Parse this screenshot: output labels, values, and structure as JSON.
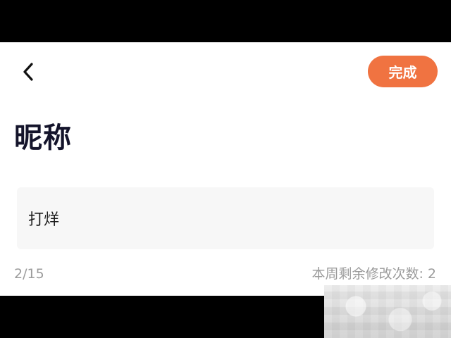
{
  "colors": {
    "accent": "#F07341",
    "title": "#14142B",
    "input_background": "#F7F7F7",
    "input_text": "#1A1A1A",
    "muted_text": "#9B9B9B"
  },
  "header": {
    "back_icon": "chevron-left-icon",
    "done_label": "完成"
  },
  "page": {
    "title": "昵称"
  },
  "nickname": {
    "value": "打烊",
    "placeholder": ""
  },
  "footer": {
    "char_count": "2/15",
    "remaining_changes": "本周剩余修改次数: 2"
  }
}
